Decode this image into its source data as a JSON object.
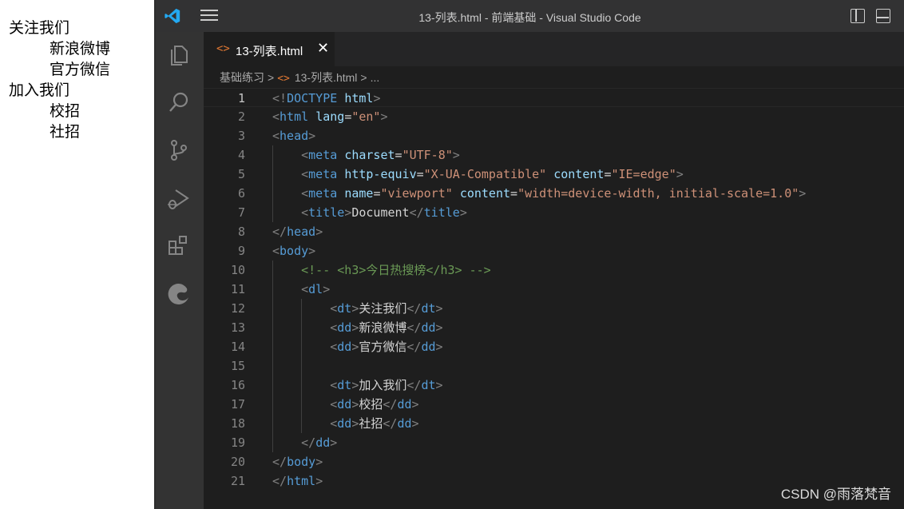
{
  "preview": {
    "items": [
      {
        "type": "dt",
        "text": "关注我们"
      },
      {
        "type": "dd",
        "text": "新浪微博"
      },
      {
        "type": "dd",
        "text": "官方微信"
      },
      {
        "type": "dt",
        "text": "加入我们"
      },
      {
        "type": "dd",
        "text": "校招"
      },
      {
        "type": "dd",
        "text": "社招"
      }
    ]
  },
  "window": {
    "title": "13-列表.html - 前端基础 - Visual Studio Code",
    "app_icon": "vscode-logo-icon"
  },
  "activity_bar": {
    "icons": [
      "explorer-icon",
      "search-icon",
      "source-control-icon",
      "run-debug-icon",
      "extensions-icon",
      "edge-icon"
    ]
  },
  "tab": {
    "label": "13-列表.html",
    "icon": "html-file-icon",
    "close": "✕"
  },
  "breadcrumb": {
    "folder": "基础练习",
    "file": "13-列表.html",
    "more": "...",
    "sep": ">"
  },
  "editor": {
    "current_line": 1,
    "lines": [
      "<!DOCTYPE html>",
      "<html lang=\"en\">",
      "<head>",
      "    <meta charset=\"UTF-8\">",
      "    <meta http-equiv=\"X-UA-Compatible\" content=\"IE=edge\">",
      "    <meta name=\"viewport\" content=\"width=device-width, initial-scale=1.0\">",
      "    <title>Document</title>",
      "</head>",
      "<body>",
      "    <!-- <h3>今日热搜榜</h3> -->",
      "    <dl>",
      "        <dt>关注我们</dt>",
      "        <dd>新浪微博</dd>",
      "        <dd>官方微信</dd>",
      "",
      "        <dt>加入我们</dt>",
      "        <dd>校招</dd>",
      "        <dd>社招</dd>",
      "    </dd>",
      "</body>",
      "</html>"
    ]
  },
  "watermark": "CSDN @雨落梵音"
}
